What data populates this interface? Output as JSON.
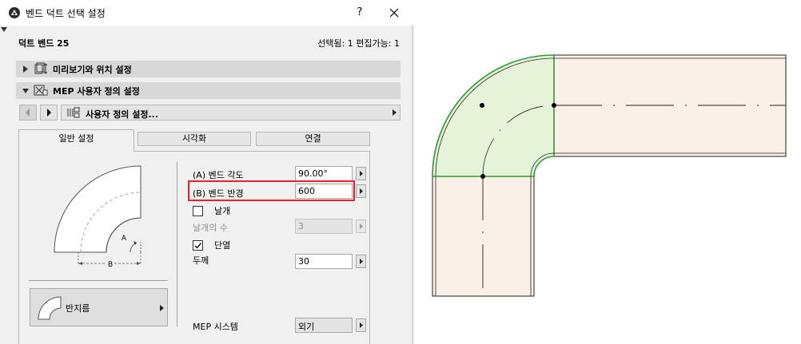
{
  "window": {
    "title": "벤드 덕트 선택 설정",
    "help": "?"
  },
  "header": {
    "element_name": "덕트 벤드 25",
    "selection_info": "선택됨: 1 편집가능: 1"
  },
  "sections": [
    {
      "label": "미리보기와 위치 설정",
      "expanded": false
    },
    {
      "label": "MEP 사용자 정의 설정",
      "expanded": true
    }
  ],
  "custom_settings": {
    "label": "사용자 정의 설정..."
  },
  "tabs": [
    {
      "label": "일반 설정",
      "active": true
    },
    {
      "label": "시각화",
      "active": false
    },
    {
      "label": "연결",
      "active": false
    }
  ],
  "preview": {
    "label_a": "A",
    "label_b": "B"
  },
  "shape_button": {
    "label": "반지름"
  },
  "fields": {
    "bend_angle": {
      "label": "(A) 벤드 각도",
      "value": "90.00°"
    },
    "bend_radius": {
      "label": "(B) 벤드 반경",
      "value": "600"
    },
    "vanes": {
      "label": "날개",
      "checked": false
    },
    "vane_count": {
      "label": "날개의 수",
      "value": "3",
      "enabled": false
    },
    "insulation": {
      "label": "단열",
      "checked": true
    },
    "thickness": {
      "label": "두께",
      "value": "30"
    },
    "mep_system": {
      "label": "MEP 시스템",
      "value": "외기"
    }
  },
  "colors": {
    "highlight": "#e8212b",
    "bend_fill": "#e5f3d9",
    "bend_stroke": "#2e9a2e",
    "duct_fill": "#fbf0e7"
  }
}
